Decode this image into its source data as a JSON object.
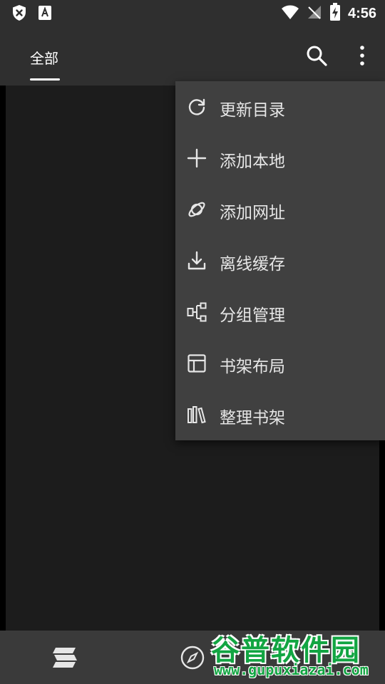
{
  "status_bar": {
    "time": "4:56",
    "icons": [
      "shield-x-icon",
      "text-a-icon",
      "wifi-icon",
      "no-signal-icon",
      "battery-charging-icon"
    ]
  },
  "app_bar": {
    "tab_label": "全部",
    "icons": [
      "search-icon",
      "more-vertical-icon"
    ]
  },
  "menu": {
    "items": [
      {
        "label": "更新目录",
        "icon": "refresh-icon"
      },
      {
        "label": "添加本地",
        "icon": "plus-icon"
      },
      {
        "label": "添加网址",
        "icon": "planet-icon"
      },
      {
        "label": "离线缓存",
        "icon": "download-icon"
      },
      {
        "label": "分组管理",
        "icon": "group-tree-icon"
      },
      {
        "label": "书架布局",
        "icon": "layout-icon"
      },
      {
        "label": "整理书架",
        "icon": "books-icon"
      }
    ]
  },
  "bottom_bar": {
    "icons": [
      "stack-icon",
      "compass-icon"
    ]
  },
  "watermark": {
    "title": "谷普软件园",
    "url": "www.gupuxiazai.com"
  },
  "colors": {
    "background": "#1c1c1c",
    "bar": "#2f2f2f",
    "menu": "#404040",
    "watermark_green": "#12a542"
  }
}
